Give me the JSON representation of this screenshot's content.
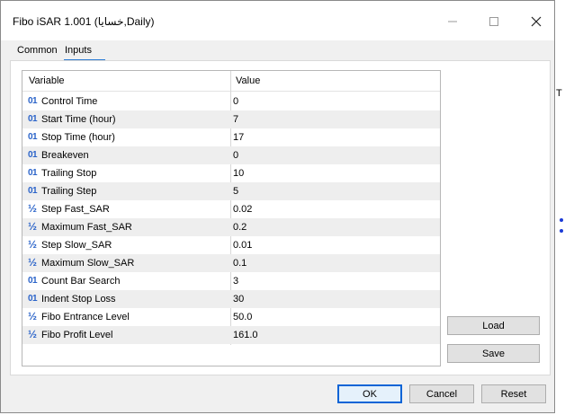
{
  "window": {
    "title": "Fibo iSAR 1.001 (خسايا,Daily)"
  },
  "tabs": [
    {
      "label": "Common",
      "active": false
    },
    {
      "label": "Inputs",
      "active": true
    }
  ],
  "grid": {
    "columns": [
      "Variable",
      "Value"
    ],
    "rows": [
      {
        "type_icon": "01",
        "name": "Control Time",
        "value": "0"
      },
      {
        "type_icon": "01",
        "name": "Start Time (hour)",
        "value": "7"
      },
      {
        "type_icon": "01",
        "name": "Stop Time (hour)",
        "value": "17"
      },
      {
        "type_icon": "01",
        "name": "Breakeven",
        "value": "0"
      },
      {
        "type_icon": "01",
        "name": "Trailing Stop",
        "value": "10"
      },
      {
        "type_icon": "01",
        "name": "Trailing Step",
        "value": "5"
      },
      {
        "type_icon": "½",
        "name": "Step Fast_SAR",
        "value": "0.02"
      },
      {
        "type_icon": "½",
        "name": "Maximum Fast_SAR",
        "value": "0.2"
      },
      {
        "type_icon": "½",
        "name": "Step Slow_SAR",
        "value": "0.01"
      },
      {
        "type_icon": "½",
        "name": "Maximum Slow_SAR",
        "value": "0.1"
      },
      {
        "type_icon": "01",
        "name": "Count Bar Search",
        "value": "3"
      },
      {
        "type_icon": "01",
        "name": "Indent Stop Loss",
        "value": "30"
      },
      {
        "type_icon": "½",
        "name": "Fibo Entrance Level",
        "value": "50.0"
      },
      {
        "type_icon": "½",
        "name": "Fibo Profit Level",
        "value": "161.0"
      }
    ]
  },
  "side_buttons": {
    "load": "Load",
    "save": "Save"
  },
  "footer": {
    "ok": "OK",
    "cancel": "Cancel",
    "reset": "Reset"
  },
  "background": {
    "tick_label": "T"
  },
  "colors": {
    "accent": "#0a64d6",
    "icon_blue": "#2a63c9",
    "dialog_bg": "#f0f0f0"
  }
}
